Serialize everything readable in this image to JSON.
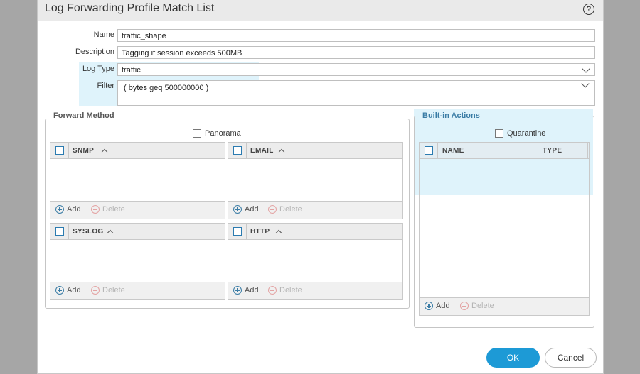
{
  "dialog": {
    "title": "Log Forwarding Profile Match List",
    "help_icon": "question-circle-icon",
    "ok_label": "OK",
    "cancel_label": "Cancel"
  },
  "form": {
    "name": {
      "label": "Name",
      "value": "traffic_shape"
    },
    "description": {
      "label": "Description",
      "value": "Tagging if session exceeds 500MB"
    },
    "log_type": {
      "label": "Log Type",
      "value": "traffic"
    },
    "filter": {
      "label": "Filter",
      "value": "( bytes geq 500000000 )"
    }
  },
  "forward_method": {
    "legend": "Forward Method",
    "panorama_label": "Panorama",
    "grids": [
      {
        "name": "SNMP",
        "add_label": "Add",
        "delete_label": "Delete"
      },
      {
        "name": "EMAIL",
        "add_label": "Add",
        "delete_label": "Delete"
      },
      {
        "name": "SYSLOG",
        "add_label": "Add",
        "delete_label": "Delete"
      },
      {
        "name": "HTTP",
        "add_label": "Add",
        "delete_label": "Delete"
      }
    ]
  },
  "builtin_actions": {
    "legend": "Built-in Actions",
    "quarantine_label": "Quarantine",
    "columns": [
      "NAME",
      "TYPE"
    ],
    "add_label": "Add",
    "delete_label": "Delete"
  },
  "colors": {
    "accent": "#1d9ad6",
    "highlight": "#dff3fb",
    "delete_disabled": "#b3b3b3"
  }
}
